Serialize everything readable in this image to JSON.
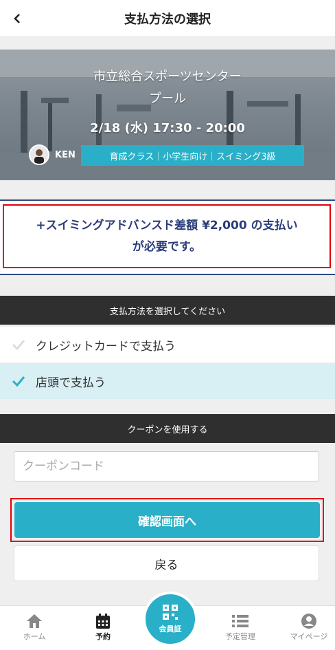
{
  "header": {
    "title": "支払方法の選択"
  },
  "hero": {
    "facility": "市立総合スポーツセンター",
    "room": "プール",
    "datetime": "2/18 (水) 17:30 - 20:00",
    "instructor": "KEN",
    "tags": "育成クラス｜小学生向け｜スイミング3級"
  },
  "notice": {
    "line1": "+スイミングアドバンスド差額 ¥2,000 の支払い",
    "line2": "が必要です。"
  },
  "payment": {
    "heading": "支払方法を選択してください",
    "options": [
      {
        "label": "クレジットカードで支払う",
        "selected": false
      },
      {
        "label": "店頭で支払う",
        "selected": true
      }
    ]
  },
  "coupon": {
    "heading": "クーポンを使用する",
    "placeholder": "クーポンコード"
  },
  "actions": {
    "confirm": "確認画面へ",
    "back": "戻る"
  },
  "nav": {
    "home": "ホーム",
    "reserve": "予約",
    "card": "会員証",
    "schedule": "予定管理",
    "mypage": "マイページ"
  },
  "colors": {
    "accent": "#29b0c8",
    "notice_text": "#2b3c7a",
    "highlight_border": "#e0000a",
    "dark_bar": "#2f2f2f"
  }
}
